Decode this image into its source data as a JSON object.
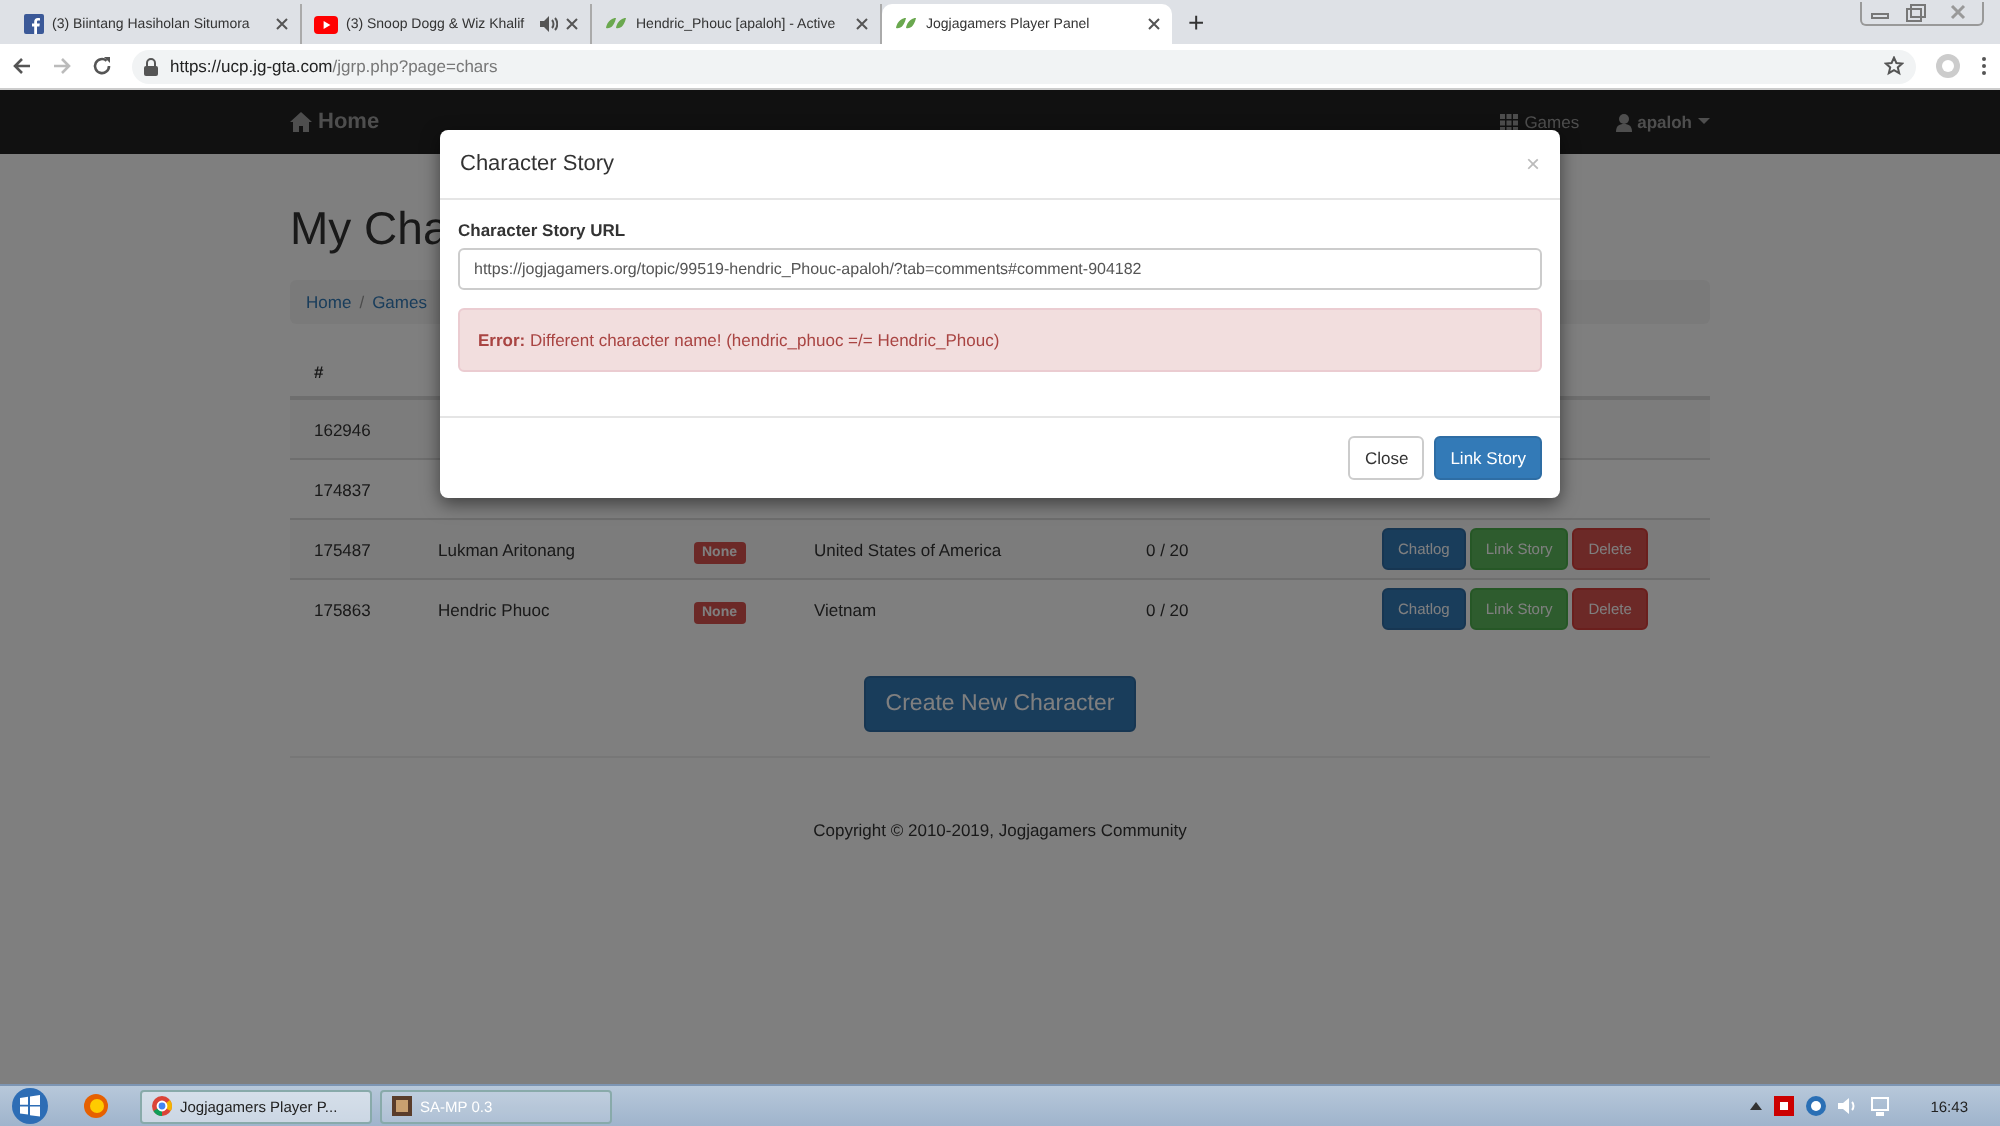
{
  "browser": {
    "tabs": [
      {
        "title": "(3) Biintang Hasiholan Situmora",
        "kind": "facebook",
        "audio": false,
        "selected": false
      },
      {
        "title": "(3) Snoop Dogg & Wiz Khalif",
        "kind": "youtube",
        "audio": true,
        "selected": false
      },
      {
        "title": "Hendric_Phouc [apaloh] - Active",
        "kind": "jg",
        "audio": false,
        "selected": false
      },
      {
        "title": "Jogjagamers Player Panel",
        "kind": "jg",
        "audio": false,
        "selected": true
      }
    ],
    "new_tab": "+",
    "address": {
      "host": "https://ucp.jg-gta.com",
      "path": "/jgrp.php?page=chars"
    }
  },
  "navbar": {
    "brand": "Home",
    "games": "Games",
    "user": "apaloh"
  },
  "page": {
    "heading": "My Cha",
    "breadcrumb": {
      "items": [
        "Home",
        "Games"
      ],
      "separator": "/"
    },
    "table": {
      "header": "#",
      "rows": [
        {
          "id": "162946"
        },
        {
          "id": "174837"
        },
        {
          "id": "175487",
          "name": "Lukman Aritonang",
          "badge": "None",
          "country": "United States of America",
          "count": "0 / 20",
          "actions": [
            "Chatlog",
            "Link Story",
            "Delete"
          ]
        },
        {
          "id": "175863",
          "name": "Hendric Phuoc",
          "badge": "None",
          "country": "Vietnam",
          "count": "0 / 20",
          "actions": [
            "Chatlog",
            "Link Story",
            "Delete"
          ]
        }
      ]
    },
    "create_button": "Create New Character",
    "footer": "Copyright © 2010-2019, Jogjagamers Community"
  },
  "modal": {
    "title": "Character Story",
    "close": "×",
    "label": "Character Story URL",
    "value": "https://jogjagamers.org/topic/99519-hendric_Phouc-apaloh/?tab=comments#comment-904182",
    "alert": "**Error:** Different character name! (hendric_phuoc =/= Hendric_Phouc)",
    "buttons": [
      "Close",
      "Link Story"
    ]
  },
  "taskbar": {
    "items": [
      {
        "title": "Jogjagamers Player P...",
        "kind": "chrome",
        "selected": true
      },
      {
        "title": "SA-MP 0.3",
        "kind": "game",
        "selected": false
      }
    ],
    "clock": "16:43"
  }
}
